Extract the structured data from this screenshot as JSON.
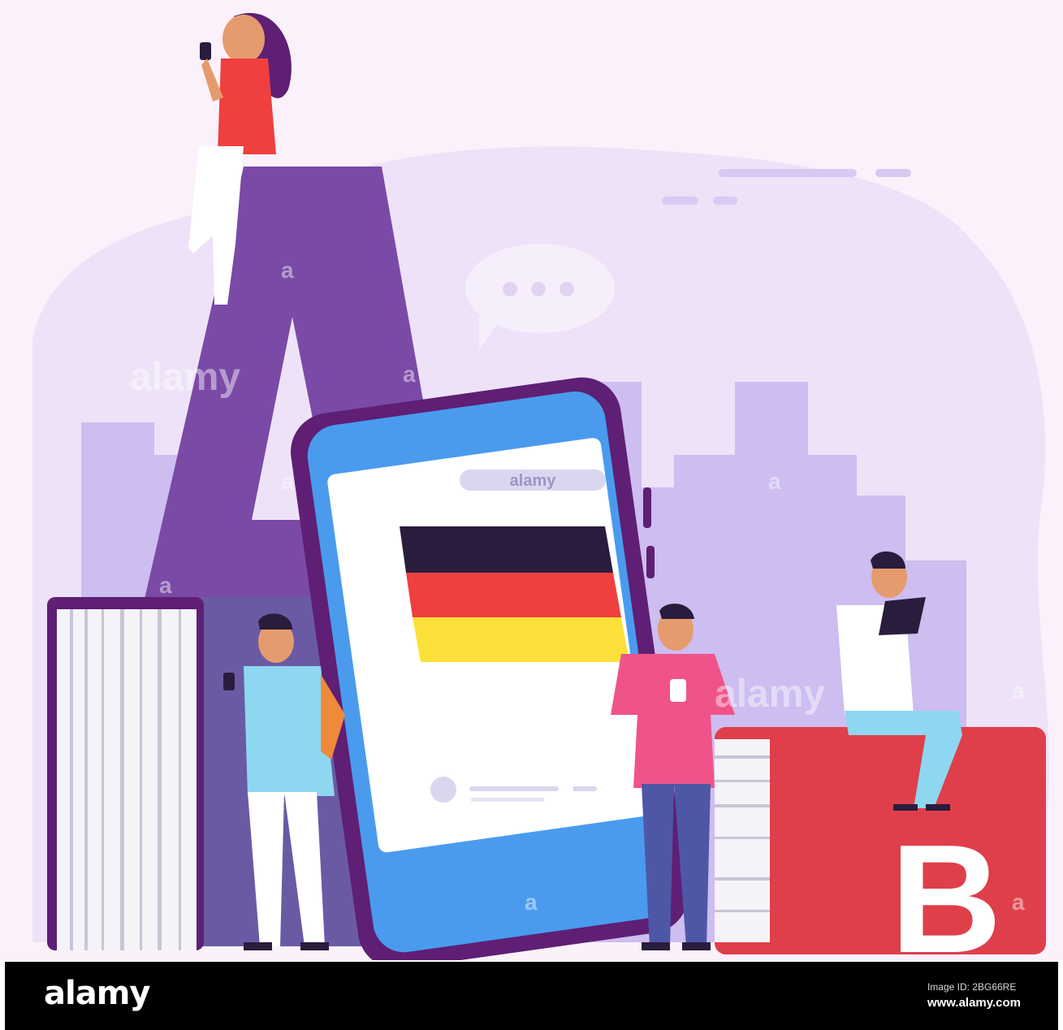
{
  "image": {
    "letters": {
      "big_a": "A",
      "big_b": "B"
    },
    "phone_screen": {
      "header_text": "alamy",
      "flag_colors": [
        "#2a1c3d",
        "#ef3f3f",
        "#fce13a"
      ]
    },
    "watermark": {
      "small_mark": "a",
      "word_mark": "alamy"
    },
    "colors": {
      "background": "#fbf1fb",
      "cloud": "#ede1f8",
      "skyline": "#cbbcef",
      "letter_a": "#7a4aa6",
      "book_b": "#df3f4a",
      "phone_frame": "#5e1f74",
      "phone_screen": "#4a9bee"
    }
  },
  "footer": {
    "brand": "alamy",
    "image_id": "Image ID: 2BG66RE",
    "url": "www.alamy.com"
  }
}
